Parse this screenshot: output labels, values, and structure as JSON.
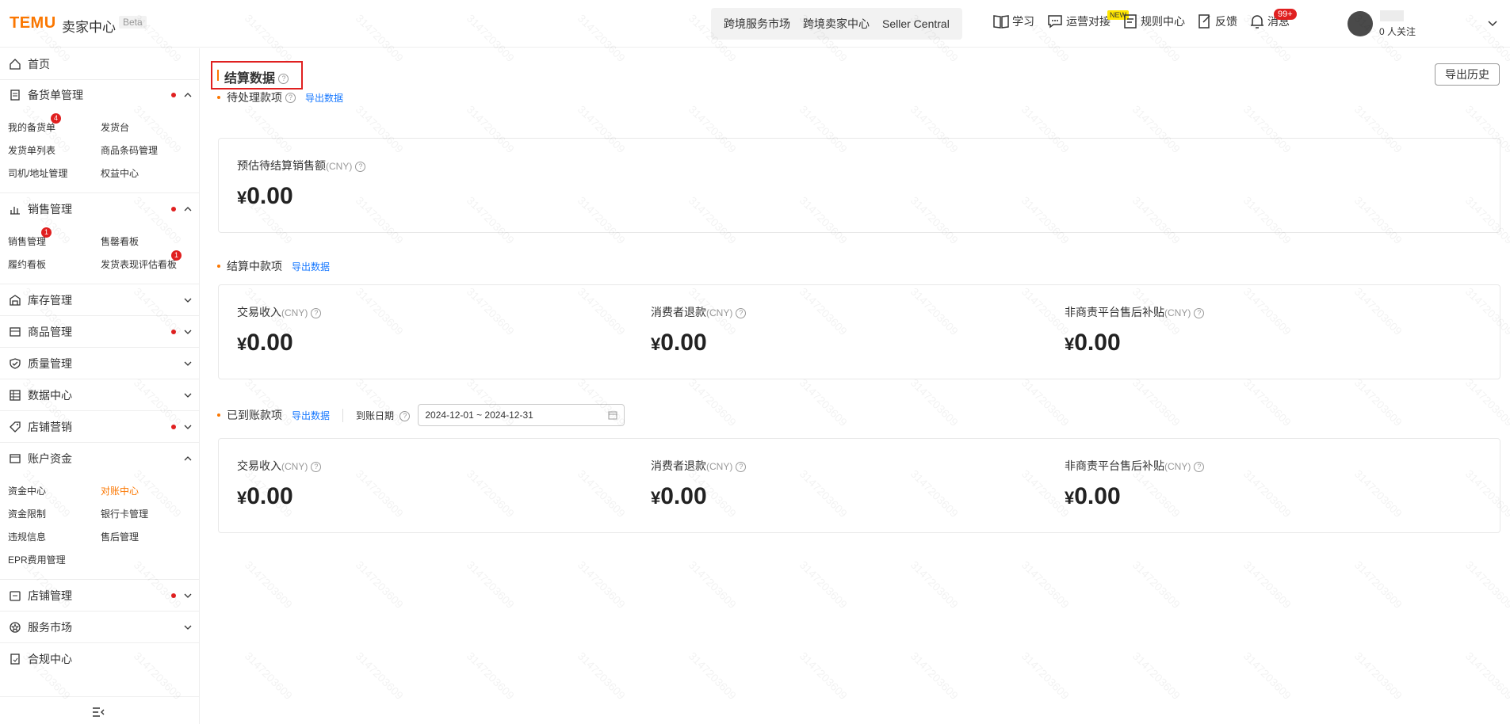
{
  "header": {
    "logo": "TEMU",
    "logo_sub": "卖家中心",
    "beta": "Beta",
    "top_nav": [
      "跨境服务市场",
      "跨境卖家中心",
      "Seller Central"
    ],
    "tools": {
      "learn": "学习",
      "ops": "运营对接",
      "ops_badge": "NEW",
      "rules": "规则中心",
      "feedback": "反馈",
      "messages": "消息",
      "messages_badge": "99+"
    },
    "follow": "0 人关注"
  },
  "sidebar": {
    "home": "首页",
    "stock": {
      "label": "备货单管理",
      "items": [
        "我的备货单",
        "发货台",
        "发货单列表",
        "商品条码管理",
        "司机/地址管理",
        "权益中心"
      ],
      "badge": "4"
    },
    "sales": {
      "label": "销售管理",
      "items": [
        "销售管理",
        "售罄看板",
        "履约看板",
        "发货表现评估看板"
      ],
      "badge1": "1",
      "badge2": "1"
    },
    "inventory": "库存管理",
    "goods": "商品管理",
    "quality": "质量管理",
    "data": "数据中心",
    "marketing": "店铺营销",
    "account": {
      "label": "账户资金",
      "items": [
        "资金中心",
        "对账中心",
        "资金限制",
        "银行卡管理",
        "违规信息",
        "售后管理",
        "EPR费用管理"
      ]
    },
    "store": "店铺管理",
    "services": "服务市场",
    "compliance": "合规中心"
  },
  "main": {
    "title": "结算数据",
    "export_history": "导出历史",
    "pending": {
      "label": "待处理款项",
      "export": "导出数据",
      "metric_label": "预估待结算销售额",
      "unit": "(CNY)",
      "yen": "¥",
      "value": "0.00"
    },
    "settling": {
      "label": "结算中款项",
      "export": "导出数据",
      "metrics": [
        {
          "label": "交易收入",
          "unit": "(CNY)",
          "yen": "¥",
          "value": "0.00"
        },
        {
          "label": "消费者退款",
          "unit": "(CNY)",
          "yen": "¥",
          "value": "0.00"
        },
        {
          "label": "非商责平台售后补贴",
          "unit": "(CNY)",
          "yen": "¥",
          "value": "0.00"
        }
      ]
    },
    "received": {
      "label": "已到账款项",
      "export": "导出数据",
      "date_label": "到账日期",
      "date_range": "2024-12-01 ~ 2024-12-31",
      "metrics": [
        {
          "label": "交易收入",
          "unit": "(CNY)",
          "yen": "¥",
          "value": "0.00"
        },
        {
          "label": "消费者退款",
          "unit": "(CNY)",
          "yen": "¥",
          "value": "0.00"
        },
        {
          "label": "非商责平台售后补贴",
          "unit": "(CNY)",
          "yen": "¥",
          "value": "0.00"
        }
      ]
    }
  },
  "watermark": "3147203609",
  "colors": {
    "brand": "#fb7701",
    "link": "#1677ff",
    "alert": "#e02020"
  }
}
